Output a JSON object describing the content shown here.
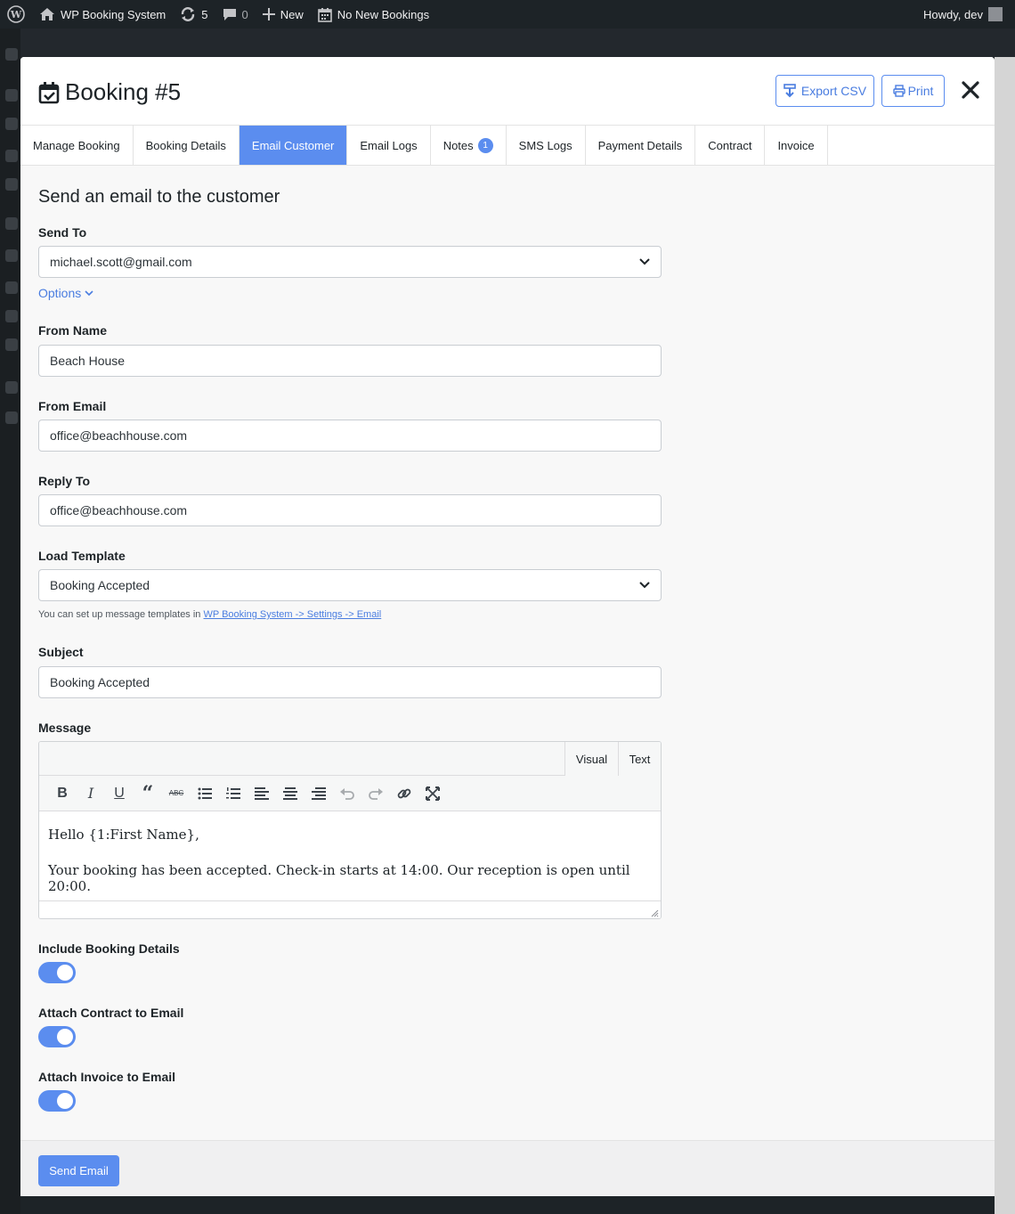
{
  "adminbar": {
    "site_name": "WP Booking System",
    "updates_count": "5",
    "comments_count": "0",
    "new_label": "New",
    "bookings_label": "No New Bookings",
    "howdy": "Howdy, dev"
  },
  "modal": {
    "title": "Booking #5",
    "export_csv": "Export CSV",
    "print": "Print"
  },
  "tabs": [
    {
      "label": "Manage Booking"
    },
    {
      "label": "Booking Details"
    },
    {
      "label": "Email Customer",
      "active": true
    },
    {
      "label": "Email Logs"
    },
    {
      "label": "Notes",
      "badge": "1"
    },
    {
      "label": "SMS Logs"
    },
    {
      "label": "Payment Details"
    },
    {
      "label": "Contract"
    },
    {
      "label": "Invoice"
    }
  ],
  "form": {
    "section_title": "Send an email to the customer",
    "send_to_label": "Send To",
    "send_to_value": "michael.scott@gmail.com",
    "options_label": "Options",
    "from_name_label": "From Name",
    "from_name_value": "Beach House",
    "from_email_label": "From Email",
    "from_email_value": "office@beachhouse.com",
    "reply_to_label": "Reply To",
    "reply_to_value": "office@beachhouse.com",
    "load_template_label": "Load Template",
    "load_template_value": "Booking Accepted",
    "hint_prefix": "You can set up message templates in ",
    "hint_link": "WP Booking System -> Settings -> Email",
    "subject_label": "Subject",
    "subject_value": "Booking Accepted",
    "message_label": "Message",
    "editor_tab_visual": "Visual",
    "editor_tab_text": "Text",
    "message_line1": "Hello {1:First Name},",
    "message_line2": "Your booking has been accepted. Check-in starts at 14:00. Our reception is open until 20:00.",
    "include_details_label": "Include Booking Details",
    "attach_contract_label": "Attach Contract to Email",
    "attach_invoice_label": "Attach Invoice to Email",
    "include_details_on": true,
    "attach_contract_on": true,
    "attach_invoice_on": true
  },
  "footer": {
    "send_label": "Send Email"
  },
  "colors": {
    "accent": "#5b8def",
    "adminbar": "#1d2327"
  }
}
